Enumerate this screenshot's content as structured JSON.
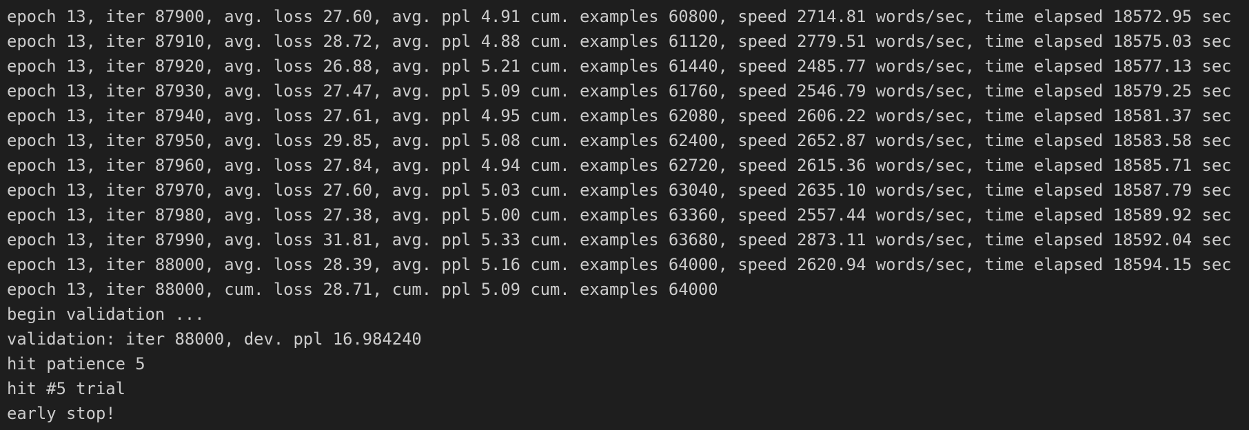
{
  "terminal": {
    "lines": [
      "epoch 13, iter 87900, avg. loss 27.60, avg. ppl 4.91 cum. examples 60800, speed 2714.81 words/sec, time elapsed 18572.95 sec",
      "epoch 13, iter 87910, avg. loss 28.72, avg. ppl 4.88 cum. examples 61120, speed 2779.51 words/sec, time elapsed 18575.03 sec",
      "epoch 13, iter 87920, avg. loss 26.88, avg. ppl 5.21 cum. examples 61440, speed 2485.77 words/sec, time elapsed 18577.13 sec",
      "epoch 13, iter 87930, avg. loss 27.47, avg. ppl 5.09 cum. examples 61760, speed 2546.79 words/sec, time elapsed 18579.25 sec",
      "epoch 13, iter 87940, avg. loss 27.61, avg. ppl 4.95 cum. examples 62080, speed 2606.22 words/sec, time elapsed 18581.37 sec",
      "epoch 13, iter 87950, avg. loss 29.85, avg. ppl 5.08 cum. examples 62400, speed 2652.87 words/sec, time elapsed 18583.58 sec",
      "epoch 13, iter 87960, avg. loss 27.84, avg. ppl 4.94 cum. examples 62720, speed 2615.36 words/sec, time elapsed 18585.71 sec",
      "epoch 13, iter 87970, avg. loss 27.60, avg. ppl 5.03 cum. examples 63040, speed 2635.10 words/sec, time elapsed 18587.79 sec",
      "epoch 13, iter 87980, avg. loss 27.38, avg. ppl 5.00 cum. examples 63360, speed 2557.44 words/sec, time elapsed 18589.92 sec",
      "epoch 13, iter 87990, avg. loss 31.81, avg. ppl 5.33 cum. examples 63680, speed 2873.11 words/sec, time elapsed 18592.04 sec",
      "epoch 13, iter 88000, avg. loss 28.39, avg. ppl 5.16 cum. examples 64000, speed 2620.94 words/sec, time elapsed 18594.15 sec",
      "epoch 13, iter 88000, cum. loss 28.71, cum. ppl 5.09 cum. examples 64000",
      "begin validation ...",
      "validation: iter 88000, dev. ppl 16.984240",
      "hit patience 5",
      "hit #5 trial",
      "early stop!"
    ]
  },
  "colors": {
    "background": "#1e1e1e",
    "text": "#cccccc"
  }
}
